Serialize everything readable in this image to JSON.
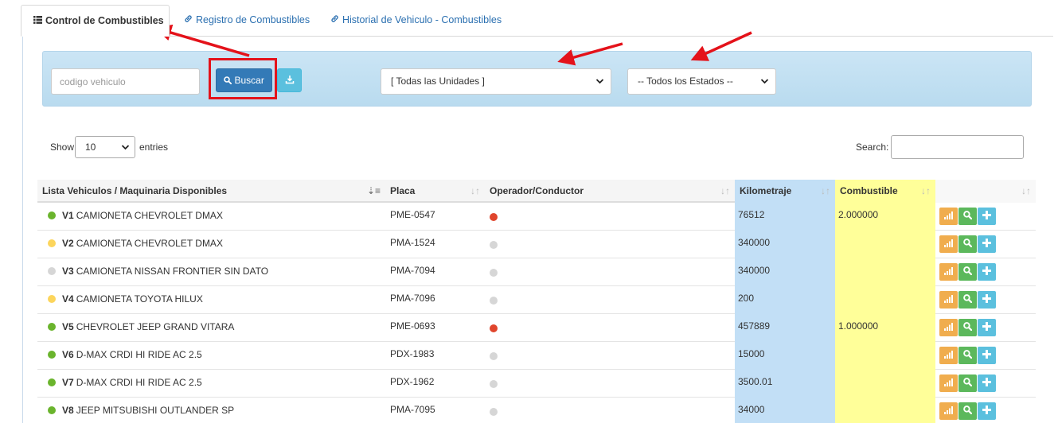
{
  "tabs": [
    {
      "label": "Control de Combustibles",
      "active": true,
      "icon": "list-icon"
    },
    {
      "label": "Registro de Combustibles",
      "active": false,
      "icon": "link-icon"
    },
    {
      "label": "Historial de Vehiculo - Combustibles",
      "active": false,
      "icon": "link-icon"
    }
  ],
  "filters": {
    "code_placeholder": "codigo vehiculo",
    "search_button": "Buscar",
    "units_selected": "[ Todas las Unidades ]",
    "states_selected": "-- Todos los Estados --"
  },
  "datatable": {
    "show_label": "Show",
    "entries_value": "10",
    "entries_label": "entries",
    "search_label": "Search:"
  },
  "columns": [
    "Lista Vehiculos / Maquinaria Disponibles",
    "Placa",
    "Operador/Conductor",
    "Kilometraje",
    "Combustible",
    ""
  ],
  "colors": {
    "status_green": "#6ab42d",
    "status_yellow": "#fcd55c",
    "status_gray": "#d6d6d6",
    "operator_red": "#e0452c",
    "operator_gray": "#d6d6d6",
    "annotation_red": "#e4121a"
  },
  "rows": [
    {
      "code": "V1",
      "name": "CAMIONETA CHEVROLET DMAX",
      "status": "green",
      "placa": "PME-0547",
      "operator": "red",
      "km": "76512",
      "fuel": "2.000000"
    },
    {
      "code": "V2",
      "name": "CAMIONETA CHEVROLET DMAX",
      "status": "yellow",
      "placa": "PMA-1524",
      "operator": "gray",
      "km": "340000",
      "fuel": ""
    },
    {
      "code": "V3",
      "name": "CAMIONETA NISSAN FRONTIER SIN DATO",
      "status": "gray",
      "placa": "PMA-7094",
      "operator": "gray",
      "km": "340000",
      "fuel": ""
    },
    {
      "code": "V4",
      "name": "CAMIONETA TOYOTA HILUX",
      "status": "yellow",
      "placa": "PMA-7096",
      "operator": "gray",
      "km": "200",
      "fuel": ""
    },
    {
      "code": "V5",
      "name": "CHEVROLET JEEP GRAND VITARA",
      "status": "green",
      "placa": "PME-0693",
      "operator": "red",
      "km": "457889",
      "fuel": "1.000000"
    },
    {
      "code": "V6",
      "name": "D-MAX CRDI HI RIDE AC 2.5",
      "status": "green",
      "placa": "PDX-1983",
      "operator": "gray",
      "km": "15000",
      "fuel": ""
    },
    {
      "code": "V7",
      "name": "D-MAX CRDI HI RIDE AC 2.5",
      "status": "green",
      "placa": "PDX-1962",
      "operator": "gray",
      "km": "3500.01",
      "fuel": ""
    },
    {
      "code": "V8",
      "name": "JEEP MITSUBISHI OUTLANDER SP",
      "status": "green",
      "placa": "PMA-7095",
      "operator": "gray",
      "km": "34000",
      "fuel": ""
    }
  ]
}
